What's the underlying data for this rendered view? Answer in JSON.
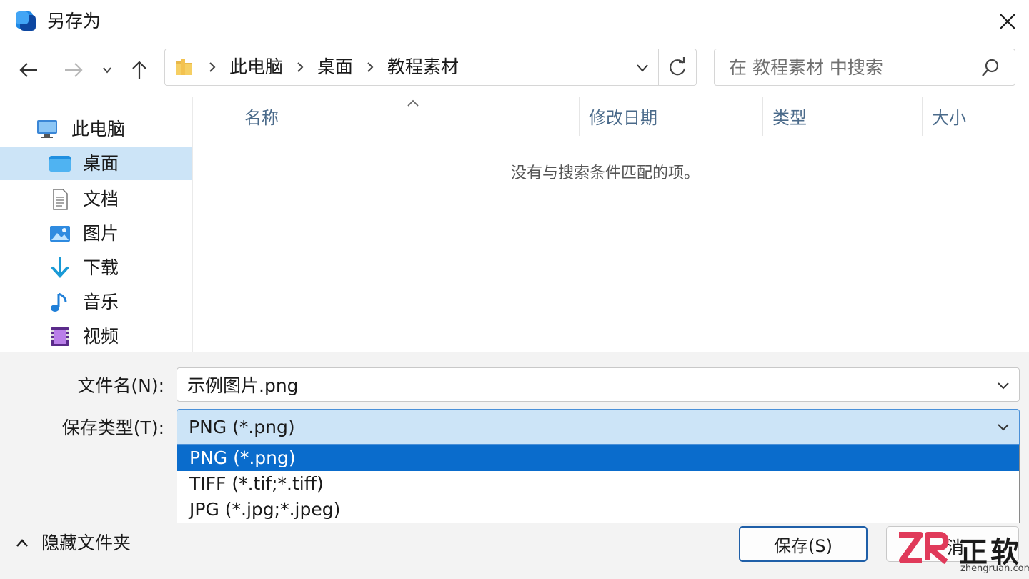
{
  "window": {
    "title": "另存为"
  },
  "address": {
    "crumbs": [
      "此电脑",
      "桌面",
      "教程素材"
    ]
  },
  "search": {
    "placeholder": "在 教程素材 中搜索"
  },
  "sidebar": {
    "items": [
      {
        "label": "此电脑",
        "icon": "computer-icon"
      },
      {
        "label": "桌面",
        "icon": "desktop-folder-icon",
        "active": true
      },
      {
        "label": "文档",
        "icon": "document-icon"
      },
      {
        "label": "图片",
        "icon": "pictures-icon"
      },
      {
        "label": "下载",
        "icon": "download-icon"
      },
      {
        "label": "音乐",
        "icon": "music-icon"
      },
      {
        "label": "视频",
        "icon": "video-icon"
      }
    ]
  },
  "list": {
    "columns": [
      "名称",
      "修改日期",
      "类型",
      "大小"
    ],
    "empty_message": "没有与搜索条件匹配的项。"
  },
  "form": {
    "filename_label": "文件名(N):",
    "filename_value": "示例图片.png",
    "type_label": "保存类型(T):",
    "type_value": "PNG (*.png)",
    "type_options": [
      "PNG (*.png)",
      "TIFF (*.tif;*.tiff)",
      "JPG (*.jpg;*.jpeg)"
    ],
    "selected_option": 0
  },
  "footer": {
    "hide_folders_label": "隐藏文件夹",
    "save_label": "保存(S)",
    "cancel_label": "消"
  },
  "watermark": {
    "brand": "正软",
    "site": "zhengruan.com"
  },
  "colors": {
    "accent": "#0a6ccc",
    "selection": "#cce4f7"
  }
}
